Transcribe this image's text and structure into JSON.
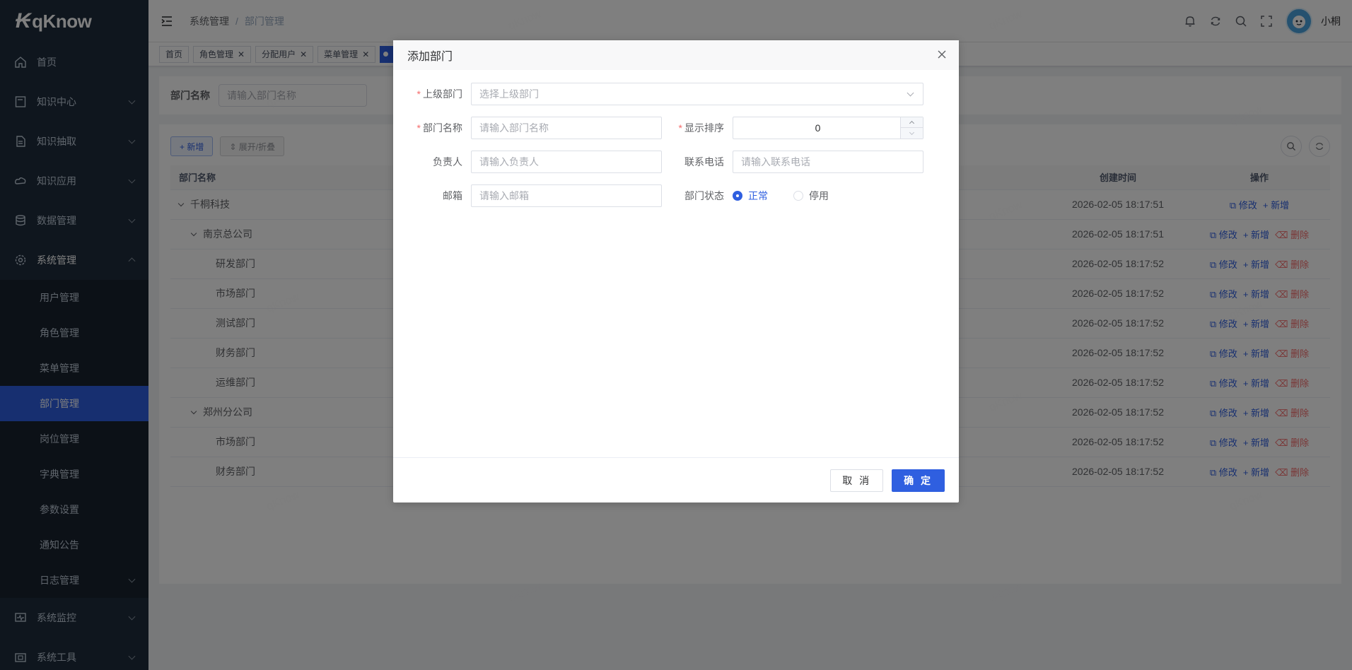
{
  "app": {
    "brand": "qKnow",
    "user": "小桐"
  },
  "sidebar": {
    "items": [
      {
        "label": "首页",
        "icon": "home-icon"
      },
      {
        "label": "知识中心",
        "icon": "book-icon"
      },
      {
        "label": "知识抽取",
        "icon": "document-icon"
      },
      {
        "label": "知识应用",
        "icon": "cloud-icon"
      },
      {
        "label": "数据管理",
        "icon": "database-icon"
      },
      {
        "label": "系统管理",
        "icon": "gear-icon"
      }
    ],
    "sub_items": [
      {
        "label": "用户管理"
      },
      {
        "label": "角色管理"
      },
      {
        "label": "菜单管理"
      },
      {
        "label": "部门管理"
      },
      {
        "label": "岗位管理"
      },
      {
        "label": "字典管理"
      },
      {
        "label": "参数设置"
      },
      {
        "label": "通知公告"
      },
      {
        "label": "日志管理"
      }
    ],
    "bottom_items": [
      {
        "label": "系统监控",
        "icon": "monitor-icon"
      },
      {
        "label": "系统工具",
        "icon": "tools-icon"
      }
    ]
  },
  "breadcrumb": {
    "parent": "系统管理",
    "current": "部门管理",
    "separator": "/"
  },
  "tags": [
    {
      "label": "首页"
    },
    {
      "label": "角色管理"
    },
    {
      "label": "分配用户"
    },
    {
      "label": "菜单管理"
    }
  ],
  "search": {
    "label": "部门名称",
    "placeholder": "请输入部门名称"
  },
  "toolbar": {
    "add": "+ 新增",
    "expand": "⇕ 展开/折叠"
  },
  "table": {
    "headers": {
      "name": "部门名称",
      "created": "创建时间",
      "ops": "操作"
    },
    "ops": {
      "edit": "修改",
      "add": "新增",
      "delete": "删除"
    },
    "rows": [
      {
        "name": "千桐科技",
        "time": "2026-02-05 18:17:51"
      },
      {
        "name": "南京总公司",
        "time": "2026-02-05 18:17:51"
      },
      {
        "name": "研发部门",
        "time": "2026-02-05 18:17:52"
      },
      {
        "name": "市场部门",
        "time": "2026-02-05 18:17:52"
      },
      {
        "name": "测试部门",
        "time": "2026-02-05 18:17:52"
      },
      {
        "name": "财务部门",
        "time": "2026-02-05 18:17:52"
      },
      {
        "name": "运维部门",
        "time": "2026-02-05 18:17:52"
      },
      {
        "name": "郑州分公司",
        "time": "2026-02-05 18:17:52"
      },
      {
        "name": "市场部门",
        "time": "2026-02-05 18:17:52"
      },
      {
        "name": "财务部门",
        "time": "2026-02-05 18:17:52"
      }
    ]
  },
  "dialog": {
    "title": "添加部门",
    "parent_label": "上级部门",
    "parent_placeholder": "选择上级部门",
    "name_label": "部门名称",
    "name_placeholder": "请输入部门名称",
    "order_label": "显示排序",
    "order_value": "0",
    "leader_label": "负责人",
    "leader_placeholder": "请输入负责人",
    "phone_label": "联系电话",
    "phone_placeholder": "请输入联系电话",
    "email_label": "邮箱",
    "email_placeholder": "请输入邮箱",
    "status_label": "部门状态",
    "status_normal": "正常",
    "status_disabled": "停用",
    "cancel": "取 消",
    "confirm": "确 定"
  },
  "watermark": "qKnow",
  "colors": {
    "primary": "#2f5fe0",
    "sidebar": "#1f2d3d",
    "danger": "#f56c6c"
  }
}
